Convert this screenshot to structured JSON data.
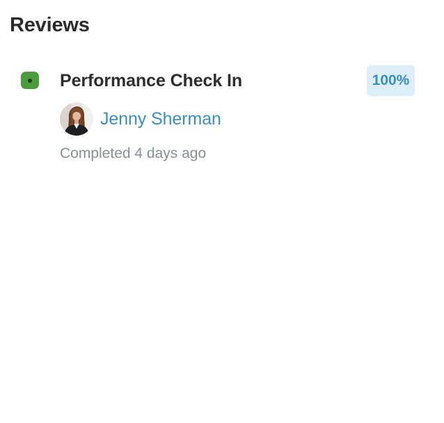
{
  "section": {
    "title": "Reviews"
  },
  "reviews": [
    {
      "title": "Performance Check In",
      "progress": "100%",
      "status_color": "#4a9b3b",
      "reviewer": {
        "name": "Jenny Sherman",
        "avatar_icon": "person-avatar"
      },
      "status_text": "Completed 4 days ago"
    }
  ],
  "colors": {
    "accent": "#3a8fc4",
    "badge_bg": "#ddeef8",
    "muted_text": "#8a8f96",
    "heading_text": "#2b2b2b"
  }
}
